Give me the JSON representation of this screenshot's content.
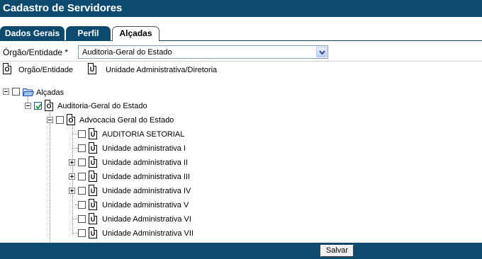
{
  "window": {
    "title": "Cadastro de Servidores"
  },
  "tabs": [
    {
      "label": "Dados Gerais",
      "active": false
    },
    {
      "label": "Perfil",
      "active": false
    },
    {
      "label": "Alçadas",
      "active": true
    }
  ],
  "form": {
    "orgao_label": "Órgão/Entidade",
    "required_marker": "*",
    "orgao_value": "Auditoria-Geral do Estado"
  },
  "legend": {
    "orgao": {
      "icon_letter": "O",
      "label": "Orgão/Entidade"
    },
    "unidade": {
      "icon_letter": "U",
      "label": "Unidade Administrativa/Diretoria"
    }
  },
  "tree": {
    "root": {
      "label": "Alçadas",
      "checked": false,
      "expanded": true
    },
    "orgao": {
      "label": "Auditoria-Geral do Estado",
      "checked": true,
      "expanded": true,
      "icon_letter": "O"
    },
    "sub_orgao": {
      "label": "Advocacia Geral do Estado",
      "checked": false,
      "expanded": true,
      "icon_letter": "O"
    },
    "unidades": [
      {
        "label": "AUDITORIA SETORIAL",
        "checked": false,
        "expandable": false,
        "icon_letter": "U"
      },
      {
        "label": "Unidade administrativa I",
        "checked": false,
        "expandable": false,
        "icon_letter": "U"
      },
      {
        "label": "Unidade administrativa II",
        "checked": false,
        "expandable": true,
        "icon_letter": "U"
      },
      {
        "label": "Unidade administrativa III",
        "checked": false,
        "expandable": true,
        "icon_letter": "U"
      },
      {
        "label": "Unidade administrativa IV",
        "checked": false,
        "expandable": true,
        "icon_letter": "U"
      },
      {
        "label": "Unidade administrativa V",
        "checked": false,
        "expandable": false,
        "icon_letter": "U"
      },
      {
        "label": "Unidade Administrativa VI",
        "checked": false,
        "expandable": false,
        "icon_letter": "U"
      },
      {
        "label": "Unidade Administrativa VII",
        "checked": false,
        "expandable": false,
        "icon_letter": "U"
      }
    ]
  },
  "footer": {
    "save_label": "Salvar"
  },
  "colors": {
    "brand": "#0d4a6e",
    "select_border": "#7f9db9",
    "checkbox_check": "#2a9d3a"
  }
}
